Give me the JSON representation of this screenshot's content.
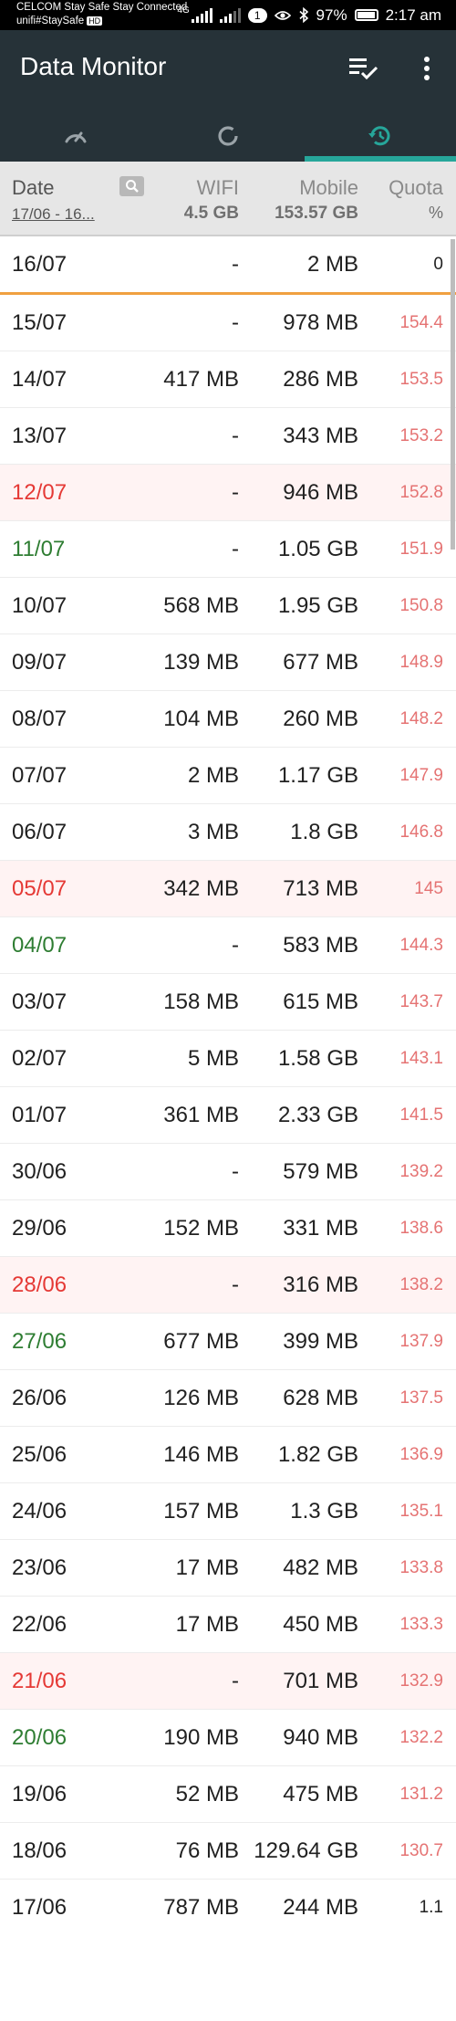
{
  "status_bar": {
    "carrier_line1": "CELCOM Stay Safe Stay Connected",
    "carrier_line2": "unifi#StaySafe",
    "hd_badge": "HD",
    "network": "4G",
    "sim_badge": "1",
    "battery": "97%",
    "time": "2:17 am"
  },
  "app_bar": {
    "title": "Data Monitor",
    "tabs": [
      {
        "icon": "gauge-icon",
        "selected": false
      },
      {
        "icon": "cycle-icon",
        "selected": false
      },
      {
        "icon": "history-icon",
        "selected": true
      }
    ]
  },
  "table_header": {
    "date_label": "Date",
    "date_range": "17/06 - 16...",
    "wifi_label": "WIFI",
    "wifi_total": "4.5 GB",
    "mobile_label": "Mobile",
    "mobile_total": "153.57 GB",
    "quota_label": "Quota",
    "quota_unit": "%"
  },
  "rows": [
    {
      "date": "16/07",
      "wifi": "-",
      "mobile": "2 MB",
      "quota": "0"
    },
    {
      "date": "15/07",
      "wifi": "-",
      "mobile": "978 MB",
      "quota": "154.4"
    },
    {
      "date": "14/07",
      "wifi": "417 MB",
      "mobile": "286 MB",
      "quota": "153.5"
    },
    {
      "date": "13/07",
      "wifi": "-",
      "mobile": "343 MB",
      "quota": "153.2"
    },
    {
      "date": "12/07",
      "wifi": "-",
      "mobile": "946 MB",
      "quota": "152.8"
    },
    {
      "date": "11/07",
      "wifi": "-",
      "mobile": "1.05 GB",
      "quota": "151.9"
    },
    {
      "date": "10/07",
      "wifi": "568 MB",
      "mobile": "1.95 GB",
      "quota": "150.8"
    },
    {
      "date": "09/07",
      "wifi": "139 MB",
      "mobile": "677 MB",
      "quota": "148.9"
    },
    {
      "date": "08/07",
      "wifi": "104 MB",
      "mobile": "260 MB",
      "quota": "148.2"
    },
    {
      "date": "07/07",
      "wifi": "2 MB",
      "mobile": "1.17 GB",
      "quota": "147.9"
    },
    {
      "date": "06/07",
      "wifi": "3 MB",
      "mobile": "1.8 GB",
      "quota": "146.8"
    },
    {
      "date": "05/07",
      "wifi": "342 MB",
      "mobile": "713 MB",
      "quota": "145"
    },
    {
      "date": "04/07",
      "wifi": "-",
      "mobile": "583 MB",
      "quota": "144.3"
    },
    {
      "date": "03/07",
      "wifi": "158 MB",
      "mobile": "615 MB",
      "quota": "143.7"
    },
    {
      "date": "02/07",
      "wifi": "5 MB",
      "mobile": "1.58 GB",
      "quota": "143.1"
    },
    {
      "date": "01/07",
      "wifi": "361 MB",
      "mobile": "2.33 GB",
      "quota": "141.5"
    },
    {
      "date": "30/06",
      "wifi": "-",
      "mobile": "579 MB",
      "quota": "139.2"
    },
    {
      "date": "29/06",
      "wifi": "152 MB",
      "mobile": "331 MB",
      "quota": "138.6"
    },
    {
      "date": "28/06",
      "wifi": "-",
      "mobile": "316 MB",
      "quota": "138.2"
    },
    {
      "date": "27/06",
      "wifi": "677 MB",
      "mobile": "399 MB",
      "quota": "137.9"
    },
    {
      "date": "26/06",
      "wifi": "126 MB",
      "mobile": "628 MB",
      "quota": "137.5"
    },
    {
      "date": "25/06",
      "wifi": "146 MB",
      "mobile": "1.82 GB",
      "quota": "136.9"
    },
    {
      "date": "24/06",
      "wifi": "157 MB",
      "mobile": "1.3 GB",
      "quota": "135.1"
    },
    {
      "date": "23/06",
      "wifi": "17 MB",
      "mobile": "482 MB",
      "quota": "133.8"
    },
    {
      "date": "22/06",
      "wifi": "17 MB",
      "mobile": "450 MB",
      "quota": "133.3"
    },
    {
      "date": "21/06",
      "wifi": "-",
      "mobile": "701 MB",
      "quota": "132.9"
    },
    {
      "date": "20/06",
      "wifi": "190 MB",
      "mobile": "940 MB",
      "quota": "132.2"
    },
    {
      "date": "19/06",
      "wifi": "52 MB",
      "mobile": "475 MB",
      "quota": "131.2"
    },
    {
      "date": "18/06",
      "wifi": "76 MB",
      "mobile": "129.64 GB",
      "quota": "130.7"
    },
    {
      "date": "17/06",
      "wifi": "787 MB",
      "mobile": "244 MB",
      "quota": "1.1"
    }
  ],
  "colors": {
    "app_bar": "#263238",
    "accent": "#26a69a",
    "today_divider": "#f0a040",
    "weekend_red": "#e53935",
    "weekend_green": "#2e7d32",
    "quota_text": "#e57373"
  }
}
